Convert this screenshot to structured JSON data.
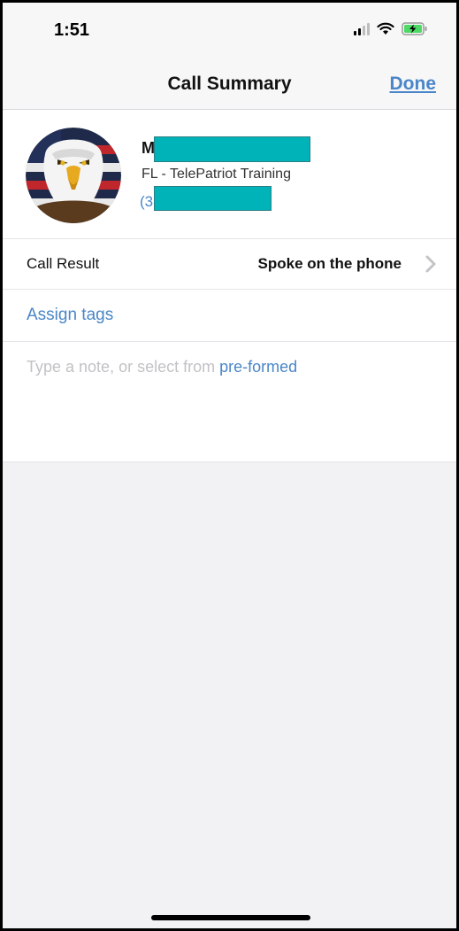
{
  "status_bar": {
    "time": "1:51",
    "icons": [
      "signal-icon",
      "wifi-icon",
      "battery-charging-icon"
    ],
    "battery_color": "#4cd964"
  },
  "nav": {
    "title": "Call Summary",
    "done_label": "Done"
  },
  "contact": {
    "name_visible": "M",
    "org": "FL - TelePatriot Training",
    "phone_visible": "(3",
    "name_redacted": true,
    "phone_redacted": true
  },
  "call_result": {
    "label": "Call Result",
    "value": "Spoke on the phone"
  },
  "tags": {
    "assign_label": "Assign tags"
  },
  "note": {
    "placeholder": "Type a note, or select from ",
    "preformed_link": "pre-formed"
  },
  "colors": {
    "accent": "#4a86c8",
    "redaction": "#00b3b8",
    "background": "#f2f2f4"
  }
}
